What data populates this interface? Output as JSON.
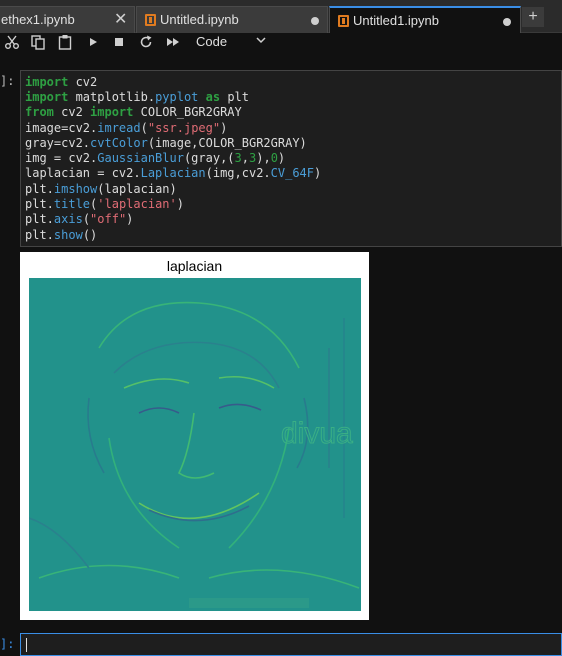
{
  "tabs": [
    {
      "label": "ethex1.ipynb",
      "state": "close"
    },
    {
      "label": "Untitled.ipynb",
      "state": "modified"
    },
    {
      "label": "Untitled1.ipynb",
      "state": "modified",
      "active": true
    }
  ],
  "toolbar": {
    "icons": [
      "cut-icon",
      "copy-icon",
      "paste-icon",
      "run-icon",
      "stop-icon",
      "restart-icon",
      "fast-forward-icon"
    ],
    "cell_type": "Code"
  },
  "cells": {
    "code_prompt": "]:",
    "code_lines": [
      "import cv2",
      "import matplotlib.pyplot as plt",
      "from cv2 import COLOR_BGR2GRAY",
      "image=cv2.imread(\"ssr.jpeg\")",
      "gray=cv2.cvtColor(image,COLOR_BGR2GRAY)",
      "img = cv2.GaussianBlur(gray,(3,3),0)",
      "laplacian = cv2.Laplacian(img,cv2.CV_64F)",
      "plt.imshow(laplacian)",
      "plt.title('laplacian')",
      "plt.axis(\"off\")",
      "plt.show()"
    ],
    "output_title": "laplacian",
    "output_watermark": "divua",
    "empty_prompt": "]:"
  },
  "colors": {
    "accent": "#3a8ee6",
    "notebook_icon": "#e07b20",
    "laplacian_base": "#21918c"
  }
}
